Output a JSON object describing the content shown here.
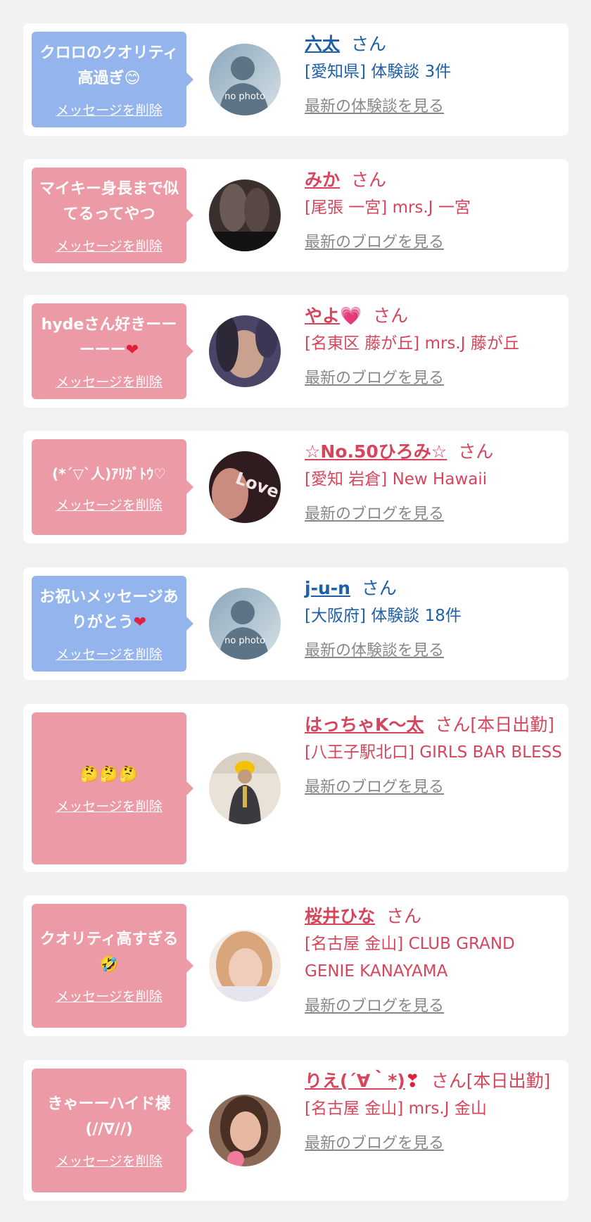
{
  "messages": [
    {
      "bubble_text": "クロロのクオリティ高過ぎ",
      "bubble_emoji": "😊",
      "delete_label": "メッセージを削除",
      "name": "六太",
      "san": "さん",
      "location": "[愛知県] 体験談 3件",
      "latest_link": "最新の体験談を見る",
      "theme": "blue",
      "avatar": "no photo"
    },
    {
      "bubble_text": "マイキー身長まで似てるってやつ",
      "delete_label": "メッセージを削除",
      "name": "みか",
      "san": "さん",
      "location": "[尾張 一宮] mrs.J 一宮",
      "latest_link": "最新のブログを見る",
      "theme": "pink"
    },
    {
      "bubble_text": "hydeさん好きーーーーー",
      "bubble_emoji": "❤",
      "delete_label": "メッセージを削除",
      "name": "やよ",
      "name_emoji": "💗",
      "san": "さん",
      "location": "[名東区 藤が丘] mrs.J 藤が丘",
      "latest_link": "最新のブログを見る",
      "theme": "pink"
    },
    {
      "bubble_text": "(*´▽`人)ｱﾘｶﾞﾄｳ♡",
      "delete_label": "メッセージを削除",
      "name": "☆No.50ひろみ☆",
      "san": "さん",
      "location": "[愛知 岩倉] New Hawaii",
      "latest_link": "最新のブログを見る",
      "theme": "pink",
      "avatar_text": "Love"
    },
    {
      "bubble_text": "お祝いメッセージありがとう",
      "bubble_emoji": "❤",
      "delete_label": "メッセージを削除",
      "name": "j-u-n",
      "san": "さん",
      "location": "[大阪府] 体験談 18件",
      "latest_link": "最新の体験談を見る",
      "theme": "blue",
      "avatar": "no photo"
    },
    {
      "bubble_text": "🤔🤔🤔",
      "delete_label": "メッセージを削除",
      "name": "はっちゃK〜太",
      "san": "さん[本日出勤]",
      "location": "[八王子駅北口] GIRLS BAR BLESS",
      "latest_link": "最新のブログを見る",
      "theme": "pink"
    },
    {
      "bubble_text": "クオリティ高すぎる",
      "bubble_emoji": "🤣",
      "delete_label": "メッセージを削除",
      "name": "桜井ひな",
      "san": "さん",
      "location": "[名古屋 金山] CLUB GRAND GENIE KANAYAMA",
      "latest_link": "最新のブログを見る",
      "theme": "pink"
    },
    {
      "bubble_text": "きゃーーハイド様(//∇//)",
      "delete_label": "メッセージを削除",
      "name": "りえ(´∀｀*)",
      "name_emoji": "❣",
      "san": "さん[本日出勤]",
      "location": "[名古屋 金山] mrs.J 金山",
      "latest_link": "最新のブログを見る",
      "theme": "pink"
    }
  ],
  "colors": {
    "blue_bubble": "#93b4ec",
    "pink_bubble": "#ec9aa6",
    "blue_text": "#1d5fa8",
    "red_text": "#d6455b",
    "link_gray": "#888888"
  }
}
